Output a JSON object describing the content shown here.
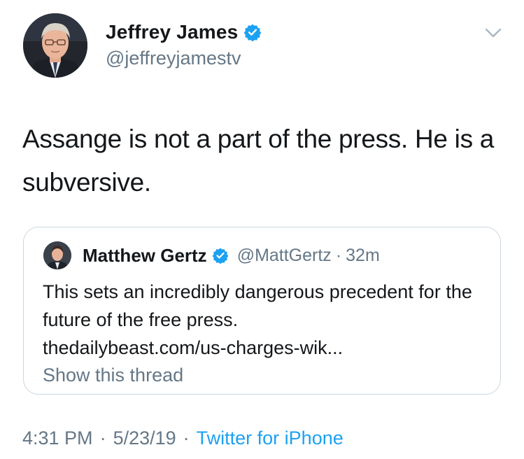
{
  "author": {
    "display_name": "Jeffrey James",
    "handle": "@jeffreyjamestv",
    "verified": true
  },
  "tweet": {
    "text": "Assange is not a part of the press. He is a subversive."
  },
  "quoted_tweet": {
    "display_name": "Matthew Gertz",
    "handle": "@MattGertz",
    "separator": "·",
    "time_ago": "32m",
    "text": "This sets an incredibly dangerous precedent for the future of the free press.",
    "link": "thedailybeast.com/us-charges-wik...",
    "show_thread": "Show this thread"
  },
  "meta": {
    "time": "4:31 PM",
    "separator": "·",
    "date": "5/23/19",
    "source": "Twitter for iPhone"
  },
  "colors": {
    "accent": "#1da1f2",
    "secondary_text": "#657786",
    "border": "#ccd6dd"
  },
  "icons": {
    "verified": "verified-badge-icon",
    "chevron": "chevron-down-icon"
  }
}
